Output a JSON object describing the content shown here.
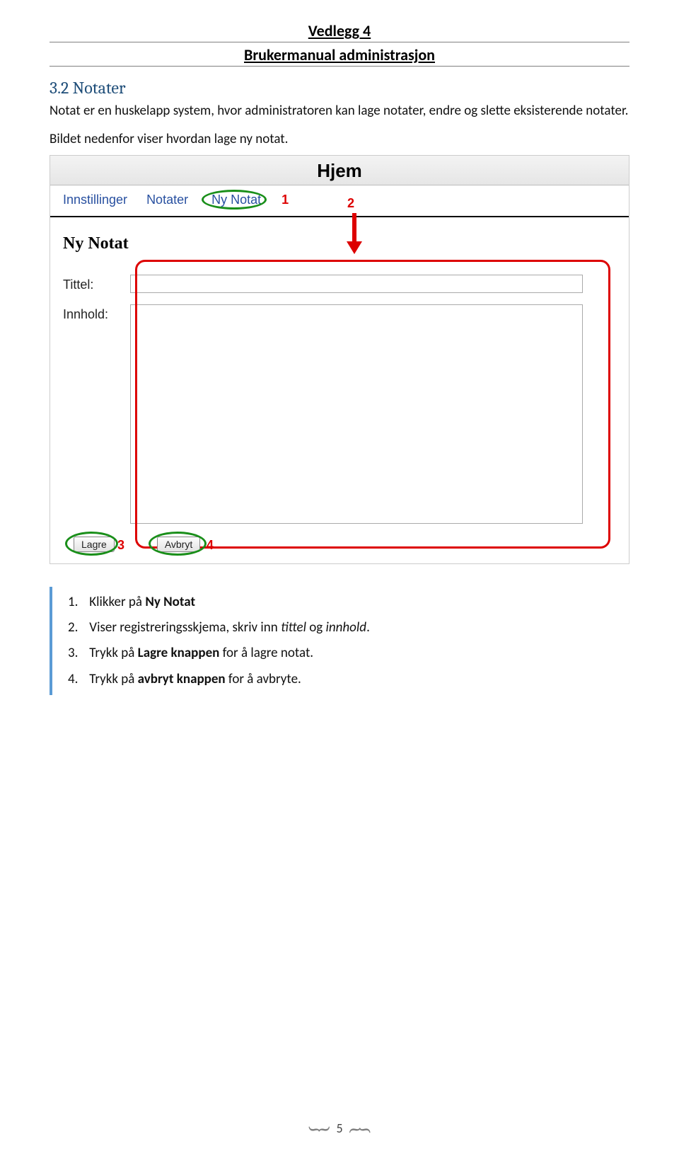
{
  "header": {
    "title": "Vedlegg 4",
    "subtitle": "Brukermanual administrasjon"
  },
  "section": {
    "heading": "3.2 Notater",
    "para1": "Notat er en huskelapp system, hvor administratoren kan lage notater, endre og slette eksisterende notater.",
    "para2": "Bildet nedenfor viser hvordan lage ny notat."
  },
  "figure": {
    "top_heading": "Hjem",
    "nav": {
      "item1": "Innstillinger",
      "item2": "Notater",
      "item3": "Ny Notat"
    },
    "callouts": {
      "c1": "1",
      "c2": "2",
      "c3": "3",
      "c4": "4"
    },
    "form": {
      "heading": "Ny Notat",
      "label_title": "Tittel:",
      "label_content": "Innhold:",
      "btn_save": "Lagre",
      "btn_cancel": "Avbryt"
    }
  },
  "steps": {
    "s1_num": "1.",
    "s1_pre": "Klikker på ",
    "s1_bold": "Ny Notat",
    "s2_num": "2.",
    "s2_pre": "Viser registreringsskjema, skriv inn ",
    "s2_em1": "tittel",
    "s2_mid": " og ",
    "s2_em2": "innhold",
    "s2_end": ".",
    "s3_num": "3.",
    "s3_pre": "Trykk på ",
    "s3_bold": "Lagre knappen",
    "s3_end": " for å lagre notat.",
    "s4_num": "4.",
    "s4_pre": "Trykk på ",
    "s4_bold": "avbryt knappen",
    "s4_end": " for å avbryte."
  },
  "page_number": "5"
}
